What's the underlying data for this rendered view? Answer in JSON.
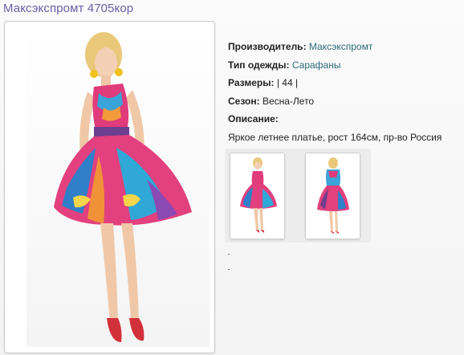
{
  "product": {
    "title": "Максэкспромт 4705кор"
  },
  "details": {
    "manufacturer_label": "Производитель:",
    "manufacturer_value": "Максэкспромт",
    "type_label": "Тип одежды:",
    "type_value": "Сарафаны",
    "sizes_label": "Размеры:",
    "sizes_value": "| 44 |",
    "season_label": "Сезон:",
    "season_value": "Весна-Лето",
    "description_label": "Описание:",
    "description_text": "Яркое летнее платье, рост 164см, пр-во Россия"
  },
  "colors": {
    "title": "#6b5ea8",
    "link": "#2b6a78"
  }
}
